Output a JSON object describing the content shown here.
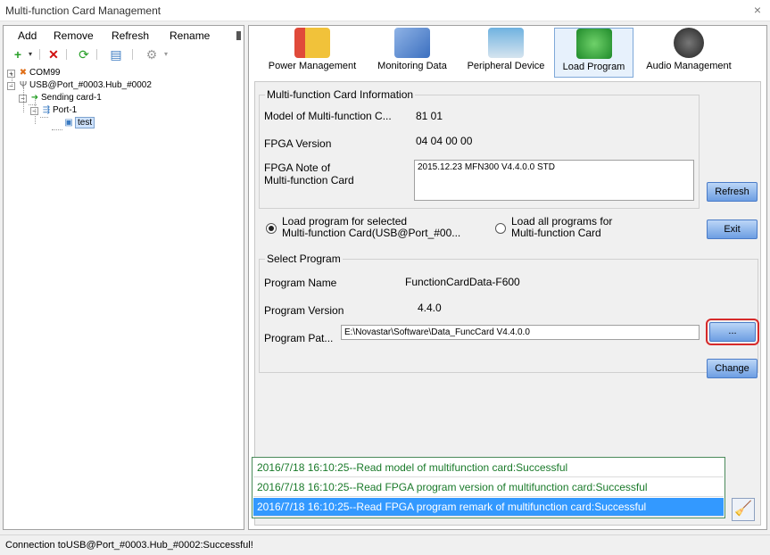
{
  "window": {
    "title": "Multi-function Card Management",
    "close": "×"
  },
  "menu": {
    "add": "Add",
    "remove": "Remove",
    "refresh": "Refresh",
    "rename": "Rename"
  },
  "tree": [
    {
      "label": "COM99",
      "icon": "com-port-icon"
    },
    {
      "label": "USB@Port_#0003.Hub_#0002",
      "icon": "usb-icon"
    },
    {
      "label": "Sending card-1",
      "icon": "arrow-icon"
    },
    {
      "label": "Port-1",
      "icon": "port-icon"
    },
    {
      "label": "test",
      "icon": "device-icon"
    }
  ],
  "tabs": [
    {
      "label": "Power Management",
      "icon": "battery-icon"
    },
    {
      "label": "Monitoring Data",
      "icon": "monitor-icon"
    },
    {
      "label": "Peripheral Device",
      "icon": "peripheral-icon"
    },
    {
      "label": "Load Program",
      "icon": "download-icon"
    },
    {
      "label": "Audio Management",
      "icon": "speaker-icon"
    }
  ],
  "info": {
    "group_title": "Multi-function Card Information",
    "model_label": "Model of Multi-function C...",
    "model_value": "81 01",
    "fpga_label": "FPGA Version",
    "fpga_value": "04 04 00 00",
    "note_label_1": "FPGA Note of",
    "note_label_2": "Multi-function Card",
    "note_value": "2015.12.23 MFN300 V4.4.0.0 STD",
    "refresh": "Refresh"
  },
  "load": {
    "selected_1": "Load program for selected",
    "selected_2": "Multi-function Card(USB@Port_#00...",
    "all_1": "Load all programs for",
    "all_2": "Multi-function Card",
    "exit": "Exit"
  },
  "program": {
    "group_title": "Select Program",
    "name_label": "Program Name",
    "name_value": "FunctionCardData-F600",
    "version_label": "Program Version",
    "version_value": "4.4.0",
    "path_label": "Program Pat...",
    "path_value": "E:\\Novastar\\Software\\Data_FuncCard  V4.4.0.0",
    "browse": "...",
    "change": "Change"
  },
  "log": [
    "2016/7/18 16:10:25--Read model of multifunction card:Successful",
    "2016/7/18 16:10:25--Read FPGA program version of multifunction card:Successful",
    "2016/7/18 16:10:25--Read FPGA program remark of multifunction card:Successful"
  ],
  "status": "Connection toUSB@Port_#0003.Hub_#0002:Successful!"
}
